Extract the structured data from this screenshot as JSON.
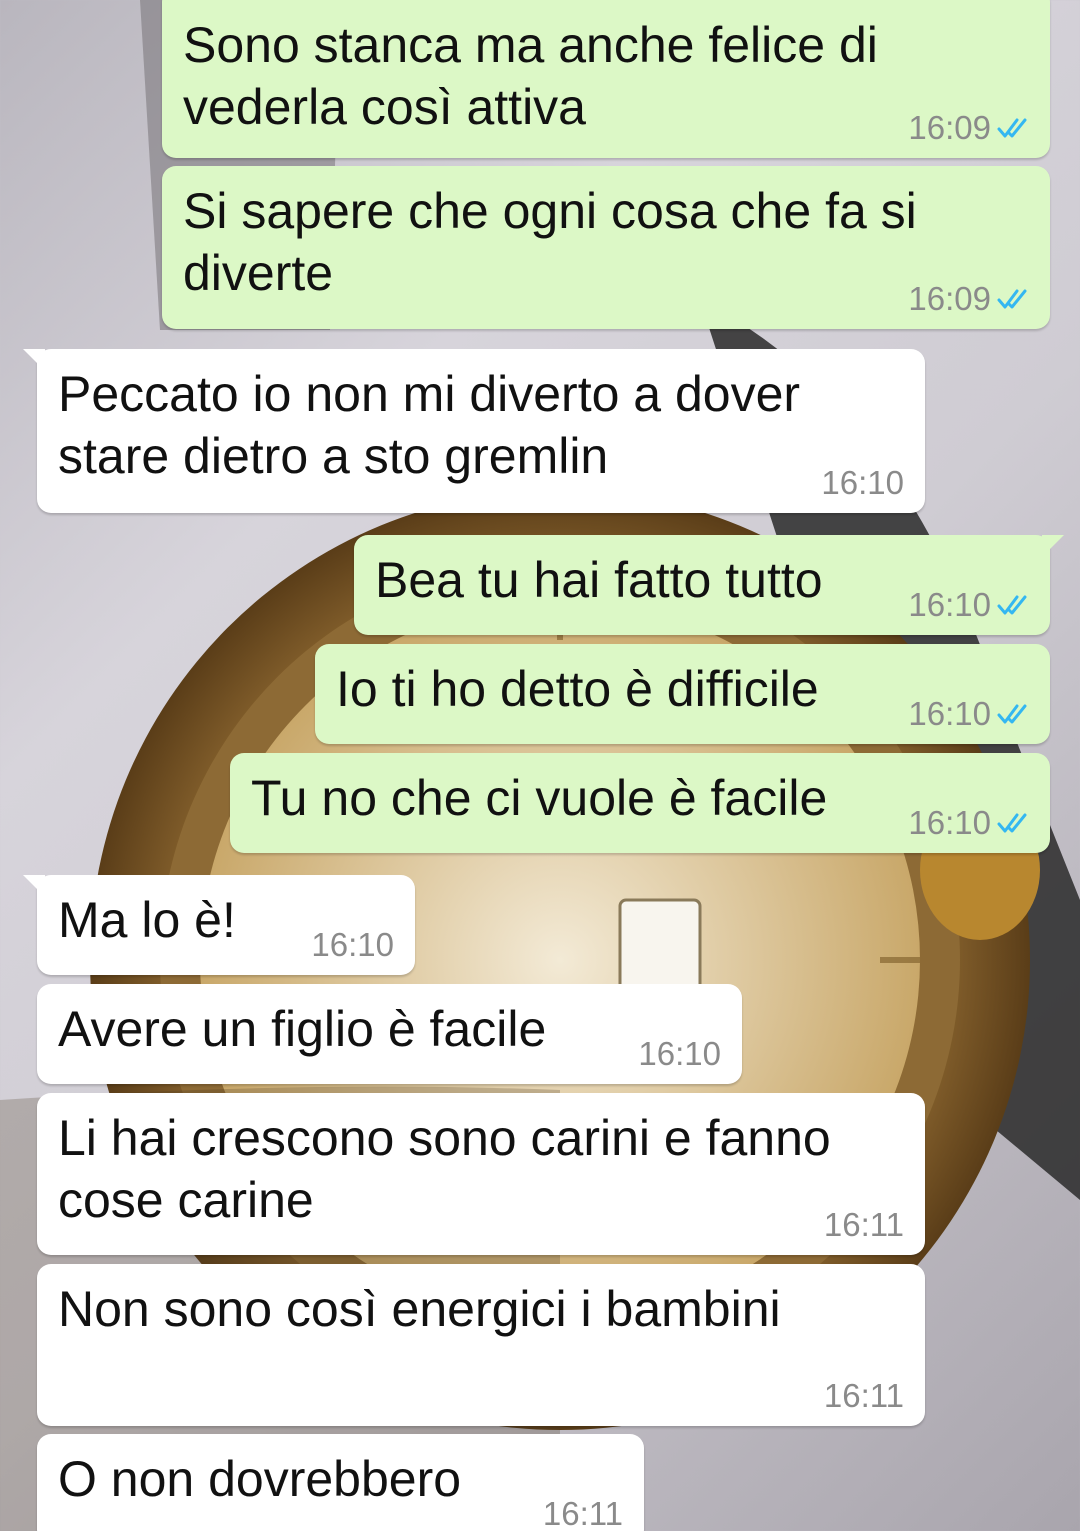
{
  "messages": [
    {
      "dir": "out",
      "lines": [
        "Sono stanca ma anche felice di",
        "vederla così attiva"
      ],
      "time": "16:09",
      "read": true
    },
    {
      "dir": "out",
      "lines": [
        "Si sapere che ogni cosa che fa si",
        "diverte"
      ],
      "time": "16:09",
      "read": true
    },
    {
      "dir": "in",
      "lines": [
        "Peccato io non mi diverto a dover",
        "stare dietro a sto gremlin"
      ],
      "time": "16:10"
    },
    {
      "dir": "out",
      "lines": [
        "Bea tu hai fatto tutto"
      ],
      "time": "16:10",
      "read": true
    },
    {
      "dir": "out",
      "lines": [
        "Io ti ho detto è difficile"
      ],
      "time": "16:10",
      "read": true
    },
    {
      "dir": "out",
      "lines": [
        "Tu no che ci vuole è facile"
      ],
      "time": "16:10",
      "read": true
    },
    {
      "dir": "in",
      "lines": [
        "Ma lo è!"
      ],
      "time": "16:10"
    },
    {
      "dir": "in",
      "lines": [
        "Avere un figlio è facile"
      ],
      "time": "16:10"
    },
    {
      "dir": "in",
      "lines": [
        "Li hai crescono sono carini e fanno",
        "cose carine"
      ],
      "time": "16:11"
    },
    {
      "dir": "in",
      "lines": [
        "Non sono così energici i bambini"
      ],
      "time": "16:11"
    },
    {
      "dir": "in",
      "lines": [
        "O non dovrebbero"
      ],
      "time": "16:11"
    }
  ],
  "colors": {
    "outgoing_bubble": "#dcf8c6",
    "incoming_bubble": "#ffffff",
    "read_tick": "#34b7f1",
    "timestamp": "#8a8a8a"
  },
  "icons": {
    "read_receipt": "double-check-icon"
  }
}
